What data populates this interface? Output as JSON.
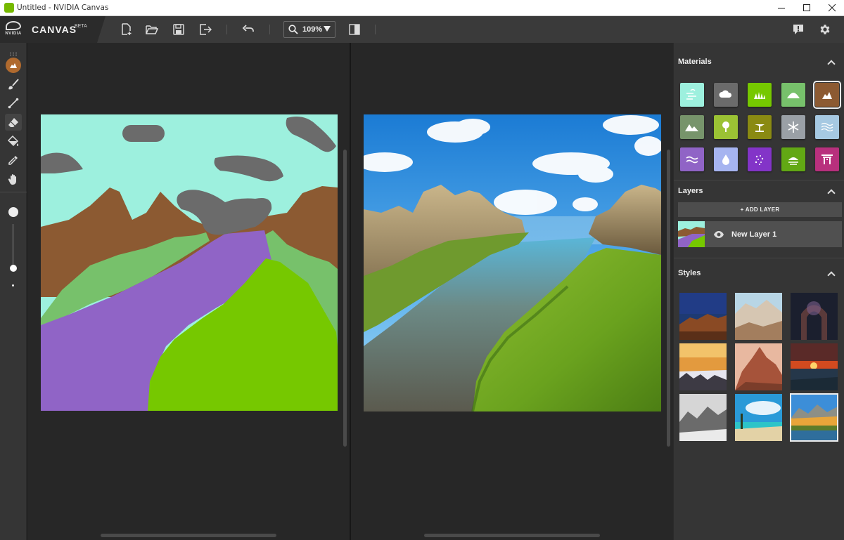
{
  "window": {
    "title": "Untitled - NVIDIA Canvas",
    "minimize": "—",
    "maximize": "☐",
    "close": "✕"
  },
  "brand": {
    "logo_text": "NVIDIA",
    "name": "CANVAS",
    "badge": "BETA"
  },
  "toolbar": {
    "buttons": [
      "new-file",
      "open-file",
      "save",
      "export",
      "undo",
      "toggle-view"
    ],
    "zoom_value": "109%"
  },
  "tools": [
    "material-tool",
    "brush",
    "line",
    "eraser",
    "fill",
    "eyedropper",
    "pan"
  ],
  "active_tool": "eraser",
  "brush_size": 0.95,
  "materials": {
    "title": "Materials",
    "items": [
      {
        "name": "sky",
        "color": "#9df0de"
      },
      {
        "name": "cloud",
        "color": "#6b6b6b"
      },
      {
        "name": "grass",
        "color": "#76c800"
      },
      {
        "name": "hill",
        "color": "#77c16b"
      },
      {
        "name": "rock",
        "color": "#8c5a32"
      },
      {
        "name": "mountain",
        "color": "#77946b"
      },
      {
        "name": "tree",
        "color": "#9bc234"
      },
      {
        "name": "bush",
        "color": "#8a8a12"
      },
      {
        "name": "snow",
        "color": "#9aa0a6"
      },
      {
        "name": "sea",
        "color": "#a6c9e2"
      },
      {
        "name": "river",
        "color": "#9064c6"
      },
      {
        "name": "water",
        "color": "#a6b4f0"
      },
      {
        "name": "fog",
        "color": "#8334c8"
      },
      {
        "name": "plant",
        "color": "#62a814"
      },
      {
        "name": "gate",
        "color": "#b8307d"
      }
    ],
    "selected": "rock"
  },
  "layers": {
    "title": "Layers",
    "add_label": "+ ADD LAYER",
    "items": [
      {
        "name": "New Layer 1"
      }
    ]
  },
  "styles": {
    "title": "Styles",
    "count": 9,
    "selected_index": 8
  },
  "colors": {
    "sky": "#9df0de",
    "cloud": "#6b6b6b",
    "mountain": "#8c5a32",
    "hill": "#77c16b",
    "river": "#9064c6",
    "grass": "#76c800"
  }
}
